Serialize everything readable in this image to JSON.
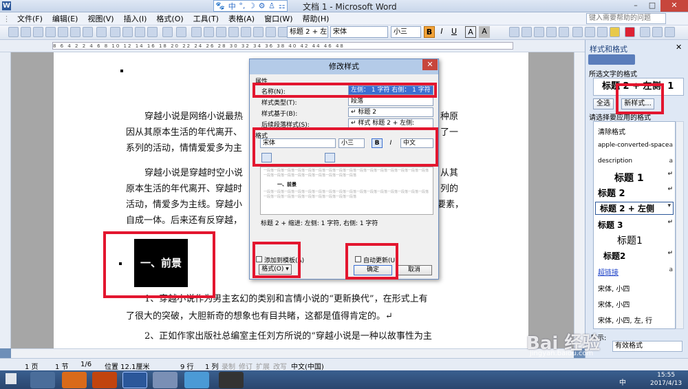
{
  "window": {
    "title": "文档 1 - Microsoft Word",
    "app_icon": "W",
    "controls": {
      "minimize": "–",
      "maximize": "□",
      "close": "✕"
    }
  },
  "ime_bar": {
    "items": [
      "🐾",
      "中",
      "°,",
      "☽",
      "⚙",
      "♙",
      "⚏"
    ]
  },
  "menubar": {
    "items": [
      "文件(F)",
      "编辑(E)",
      "视图(V)",
      "插入(I)",
      "格式(O)",
      "工具(T)",
      "表格(A)",
      "窗口(W)",
      "帮助(H)"
    ],
    "help_placeholder": "键入需要帮助的问题"
  },
  "toolbar": {
    "style_combo": "标题 2 + 左",
    "font_combo": "宋体",
    "size_combo": "小三",
    "bold": "B",
    "italic": "I",
    "underline": "U",
    "border": "A",
    "scale": "A"
  },
  "ruler": {
    "scale_text": "8 6 4 2 2 4 6 8 10 12 14 16 18 20 22 24 26 28 30 32 34 36 38 40 42 44 46 48"
  },
  "document": {
    "para1_line1": "穿越小说是网络小说最热",
    "para1_line1_end": "种原",
    "para1_line2": "因从其原本生活的年代离开、",
    "para1_line2_end": "了一",
    "para1_line3": "系列的活动，情情爱爱多为主",
    "para2_line1": "穿越小说是穿越时空小说",
    "para2_line1_end": "从其",
    "para2_line2": "原本生活的年代离开、穿越时",
    "para2_line2_end": "列的",
    "para2_line3": "活动，情爱多为主线。穿越小",
    "para2_line3_end": "要素，",
    "para2_line4": "自成一体。后来还有反穿越，",
    "heading": "一、前景",
    "para3_line1": "1、穿越小说作为男主玄幻的类别和言情小说的“更新换代”，在形式上有",
    "para3_line2": "了很大的突破，大胆新奇的想象也有目共睹，这都是值得肯定的。↵",
    "para4_line1": "2、正如作家出版社总编室主任刘方所说的“穿越小说是一种以故事性为主"
  },
  "dialog": {
    "title": "修改样式",
    "section_props": "属性",
    "name_label": "名称(N):",
    "name_value": "左侧： 1 字符 右侧： 1 字符",
    "type_label": "样式类型(T):",
    "type_value": "段落",
    "based_label": "样式基于(B):",
    "based_value": "↵ 标题 2",
    "next_label": "后续段落样式(S):",
    "next_value": "↵ 样式 标题 2 + 左侧:",
    "section_format": "格式",
    "font": "宋体",
    "size": "小三",
    "bold": "B",
    "italic": "I",
    "lang": "中文",
    "preview_heading": "一、前景",
    "preview_filler": "一段落一段落一段落一段落一段落一段落一段落一段落一段落一段落一段落一段落一段落一段落一段落一段落一段落一段落一段落一段落一段落一段落一段落一段落一段落",
    "description": "标题 2 + 缩进: 左侧:  1 字符, 右侧:  1 字符",
    "add_template": "添加到模板(A)",
    "auto_update": "自动更新(U)",
    "format_btn": "格式(O) ▾",
    "ok": "确定",
    "cancel": "取消",
    "close": "✕"
  },
  "pane": {
    "title": "样式和格式",
    "close": "✕",
    "current_label": "所选文字的格式",
    "current_style": "标题 2 + 左侧: 1",
    "select_all": "全选",
    "new_style": "新样式...",
    "pick_label": "请选择要应用的格式",
    "items": [
      {
        "label": "清除格式",
        "mark": ""
      },
      {
        "label": "apple-converted-space",
        "mark": "a"
      },
      {
        "label": "description",
        "mark": "a"
      },
      {
        "label": "标题 1",
        "mark": "↵"
      },
      {
        "label": "标题 2",
        "mark": "↵"
      },
      {
        "label": "标题 2 + 左侧",
        "mark": "▾"
      },
      {
        "label": "标题 3",
        "mark": "↵"
      },
      {
        "label": "标题1",
        "mark": ""
      },
      {
        "label": "标题2",
        "mark": "↵"
      },
      {
        "label": "超链接",
        "mark": "a"
      },
      {
        "label": "宋体, 小四",
        "mark": ""
      },
      {
        "label": "宋体, 小四",
        "mark": ""
      },
      {
        "label": "宋体, 小四, 左, 行",
        "mark": ""
      }
    ],
    "show_label": "显示:",
    "show_value": "有效格式"
  },
  "status": {
    "page": "1 页",
    "section": "1 节",
    "pages": "1/6",
    "position": "位置 12.1厘米",
    "line": "9 行",
    "col": "1 列",
    "rec": "录制",
    "trk": "修订",
    "ext": "扩展",
    "ovr": "改写",
    "lang": "中文(中国)"
  },
  "taskbar": {
    "time": "15:55",
    "date": "2017/4/13",
    "ime": "中"
  },
  "watermark": {
    "logo": "Bai 经验",
    "url": "jingyan.baidu.com"
  },
  "colors": {
    "annotation": "#e3162f",
    "bold_active": "#f2a33a",
    "pane_bg": "#dfe8f5"
  }
}
